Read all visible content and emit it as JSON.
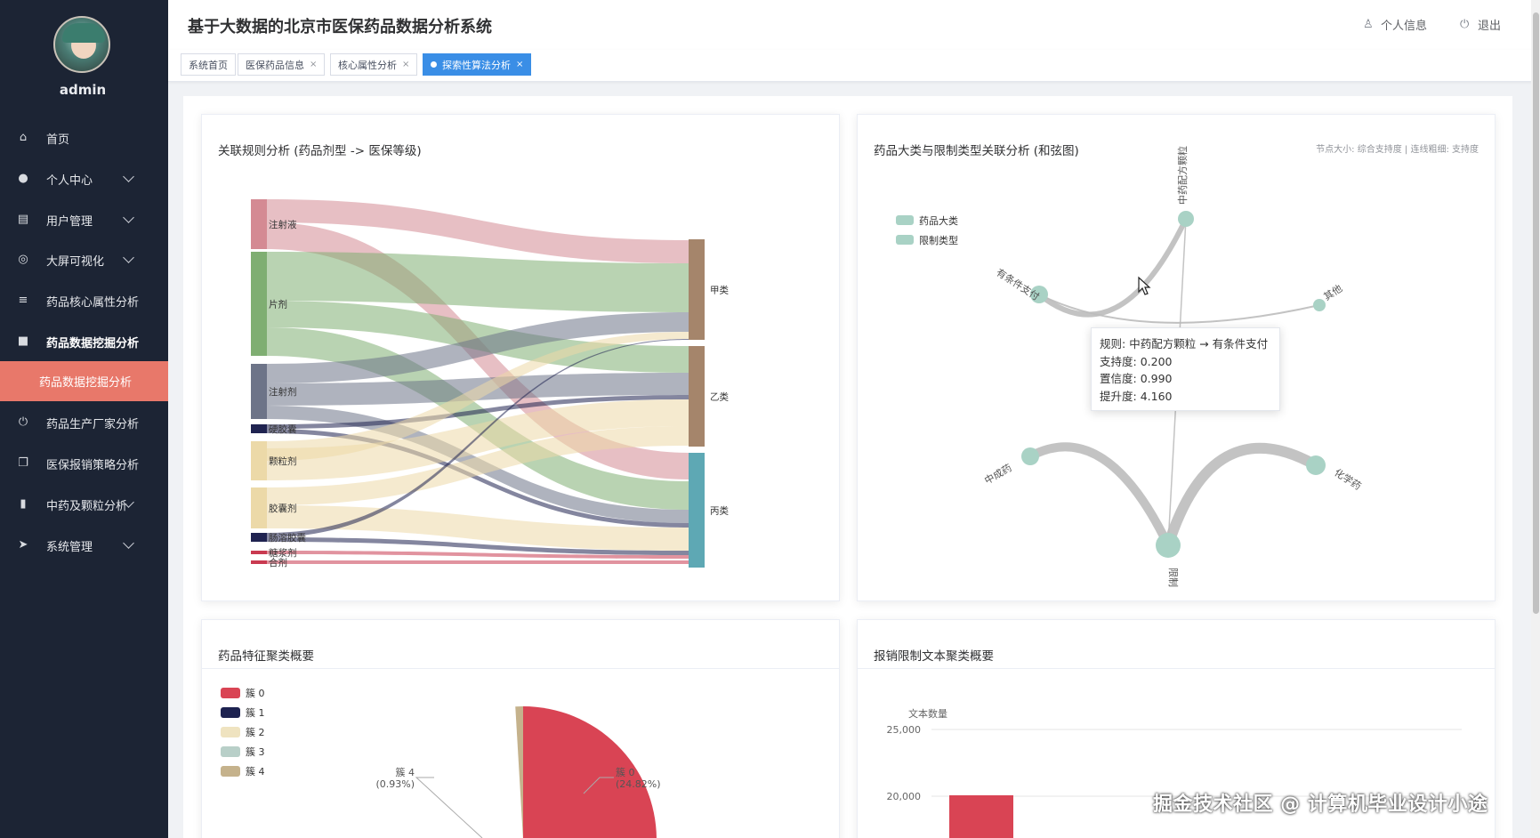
{
  "sidebar": {
    "user": "admin",
    "items": [
      {
        "label": "首页",
        "icon": "home-icon",
        "arrow": false
      },
      {
        "label": "个人中心",
        "icon": "user-icon",
        "arrow": true
      },
      {
        "label": "用户管理",
        "icon": "clipboard-icon",
        "arrow": true
      },
      {
        "label": "大屏可视化",
        "icon": "monitor-icon",
        "arrow": true
      },
      {
        "label": "药品核心属性分析",
        "icon": "list-icon",
        "arrow": false
      },
      {
        "label": "药品数据挖掘分析",
        "icon": "briefcase-icon",
        "arrow": false
      },
      {
        "label": "药品生产厂家分析",
        "icon": "power-icon",
        "arrow": false
      },
      {
        "label": "医保报销策略分析",
        "icon": "copy-icon",
        "arrow": false
      },
      {
        "label": "中药及颗粒分析",
        "icon": "bar-chart-icon",
        "arrow": true
      },
      {
        "label": "系统管理",
        "icon": "send-icon",
        "arrow": true
      }
    ],
    "active_sub": "药品数据挖掘分析"
  },
  "header": {
    "title": "基于大数据的北京市医保药品数据分析系统",
    "profile": "个人信息",
    "logout": "退出"
  },
  "tabs": [
    {
      "label": "系统首页",
      "closable": false,
      "active": false
    },
    {
      "label": "医保药品信息",
      "closable": true,
      "active": false
    },
    {
      "label": "核心属性分析",
      "closable": true,
      "active": false
    },
    {
      "label": "探索性算法分析",
      "closable": true,
      "active": true
    }
  ],
  "cards": {
    "sankey": {
      "title": "关联规则分析 (药品剂型 -> 医保等级)"
    },
    "chord": {
      "title": "药品大类与限制类型关联分析 (和弦图)",
      "hint": "节点大小: 综合支持度 | 连线粗细: 支持度"
    },
    "cluster": {
      "title": "药品特征聚类概要"
    },
    "text_cluster": {
      "title": "报销限制文本聚类概要"
    }
  },
  "chart_data": [
    {
      "type": "sankey",
      "title": "关联规则分析 (药品剂型 -> 医保等级)",
      "sources": [
        "注射液",
        "片剂",
        "注射剂",
        "硬胶囊",
        "颗粒剂",
        "胶囊剂",
        "肠溶胶囊",
        "糖浆剂",
        "合剂"
      ],
      "targets": [
        "甲类",
        "乙类",
        "丙类"
      ],
      "colors": {
        "注射液": "#d48a93",
        "片剂": "#7fae72",
        "注射剂": "#6d7488",
        "硬胶囊": "#1f2350",
        "颗粒剂": "#ecd9a8",
        "胶囊剂": "#ecd9a8",
        "肠溶胶囊": "#1f2350",
        "糖浆剂": "#c93a50",
        "合剂": "#c93a50",
        "甲类": "#a5856b",
        "乙类": "#a5856b",
        "丙类": "#5ea8b4"
      }
    },
    {
      "type": "graph",
      "title": "药品大类与限制类型关联分析 (和弦图)",
      "legend": [
        {
          "name": "药品大类",
          "color": "#a9d2c5"
        },
        {
          "name": "限制类型",
          "color": "#a9d2c5"
        }
      ],
      "nodes": [
        "中药配方颗粒",
        "有条件支付",
        "其他",
        "中成药",
        "化学药",
        "限制"
      ],
      "tooltip": {
        "rule_label": "规则:",
        "rule": "中药配方颗粒 → 有条件支付",
        "support_label": "支持度:",
        "support": "0.200",
        "confidence_label": "置信度:",
        "confidence": "0.990",
        "lift_label": "提升度:",
        "lift": "4.160"
      }
    },
    {
      "type": "pie",
      "title": "药品特征聚类概要",
      "legend": [
        {
          "name": "簇 0",
          "color": "#d94454"
        },
        {
          "name": "簇 1",
          "color": "#1d2250"
        },
        {
          "name": "簇 2",
          "color": "#efe3c0"
        },
        {
          "name": "簇 3",
          "color": "#b8cfc8"
        },
        {
          "name": "簇 4",
          "color": "#c5b28c"
        }
      ],
      "labels": [
        {
          "name": "簇 4",
          "pct": "(0.93%)"
        },
        {
          "name": "簇 0",
          "pct": "(24.82%)"
        }
      ],
      "values_pct": [
        24.82,
        0,
        0,
        0,
        0.93
      ]
    },
    {
      "type": "bar",
      "title": "报销限制文本聚类概要",
      "ylabel": "文本数量",
      "yticks": [
        "25,000",
        "20,000"
      ],
      "values": [
        20000
      ],
      "bar_color": "#d94454"
    }
  ],
  "watermark": "掘金技术社区 @ 计算机毕业设计小途"
}
